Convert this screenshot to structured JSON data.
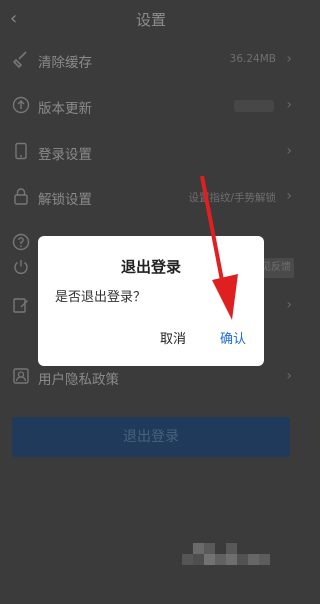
{
  "header": {
    "title": "设置",
    "back_icon": "chevron-left-icon"
  },
  "settings": [
    {
      "label": "清除缓存",
      "value": "36.24MB",
      "icon": "broom-icon"
    },
    {
      "label": "版本更新",
      "value": "",
      "icon": "update-icon"
    },
    {
      "label": "登录设置",
      "value": "",
      "icon": "phone-icon"
    },
    {
      "label": "解锁设置",
      "value": "设置指纹/手势解锁",
      "icon": "lock-icon"
    },
    {
      "label": "",
      "value": "",
      "icon": "help-icon"
    },
    {
      "label": "",
      "value": "",
      "icon": "power-icon"
    },
    {
      "label": "",
      "value": "",
      "icon": "edit-icon"
    },
    {
      "label": "用户隐私政策",
      "value": "",
      "icon": "person-icon"
    }
  ],
  "feedback_tab": "意见反馈",
  "logout_button": "退出登录",
  "dialog": {
    "title": "退出登录",
    "message": "是否退出登录？",
    "cancel": "取消",
    "confirm": "确认"
  },
  "colors": {
    "dialog_bg": "#ffffff",
    "confirm": "#1e6bd6",
    "overlay": "#3b3b3b",
    "logout_button": "#1f3a5a",
    "arrow": "#e02020"
  }
}
